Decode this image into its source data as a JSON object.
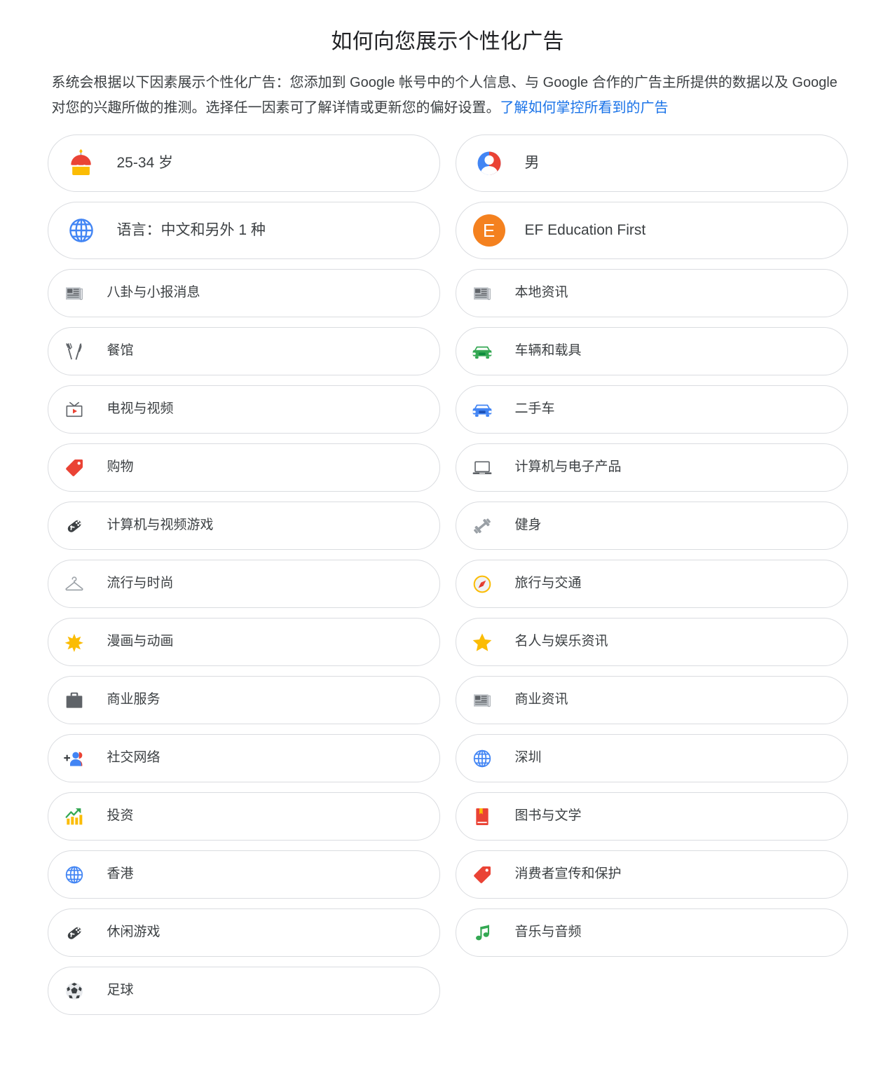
{
  "header": {
    "title": "如何向您展示个性化广告",
    "intro_text": "系统会根据以下因素展示个性化广告：您添加到 Google 帐号中的个人信息、与 Google 合作的广告主所提供的数据以及 Google 对您的兴趣所做的推测。选择任一因素可了解详情或更新您的偏好设置。",
    "intro_link": "了解如何掌控所看到的广告",
    "link_color": "#1a73e8"
  },
  "cards": {
    "left": [
      {
        "label": "25-34 岁",
        "icon": "birthday-cake-icon",
        "size": "big"
      },
      {
        "label": "语言：中文和另外 1 种",
        "icon": "globe-icon",
        "size": "big"
      },
      {
        "label": "八卦与小报消息",
        "icon": "newspaper-icon",
        "size": "small"
      },
      {
        "label": "餐馆",
        "icon": "restaurant-icon",
        "size": "small"
      },
      {
        "label": "电视与视频",
        "icon": "television-icon",
        "size": "small"
      },
      {
        "label": "购物",
        "icon": "price-tag-icon",
        "size": "small"
      },
      {
        "label": "计算机与视频游戏",
        "icon": "gamepad-icon",
        "size": "small"
      },
      {
        "label": "流行与时尚",
        "icon": "clothes-hanger-icon",
        "size": "small"
      },
      {
        "label": "漫画与动画",
        "icon": "sparkle-star-icon",
        "size": "small"
      },
      {
        "label": "商业服务",
        "icon": "briefcase-icon",
        "size": "small"
      },
      {
        "label": "社交网络",
        "icon": "add-person-icon",
        "size": "small"
      },
      {
        "label": "投资",
        "icon": "growth-chart-icon",
        "size": "small"
      },
      {
        "label": "香港",
        "icon": "globe-icon",
        "size": "small"
      },
      {
        "label": "休闲游戏",
        "icon": "gamepad-icon",
        "size": "small"
      },
      {
        "label": "足球",
        "icon": "soccer-ball-icon",
        "size": "small"
      }
    ],
    "right": [
      {
        "label": "男",
        "icon": "person-avatar-icon",
        "size": "big"
      },
      {
        "label": "EF Education First",
        "icon": "letter-avatar-E",
        "size": "big"
      },
      {
        "label": "本地资讯",
        "icon": "newspaper-icon",
        "size": "small"
      },
      {
        "label": "车辆和载具",
        "icon": "car-green-icon",
        "size": "small"
      },
      {
        "label": "二手车",
        "icon": "car-blue-icon",
        "size": "small"
      },
      {
        "label": "计算机与电子产品",
        "icon": "laptop-icon",
        "size": "small"
      },
      {
        "label": "健身",
        "icon": "dumbbell-icon",
        "size": "small"
      },
      {
        "label": "旅行与交通",
        "icon": "compass-icon",
        "size": "small"
      },
      {
        "label": "名人与娱乐资讯",
        "icon": "star-icon",
        "size": "small"
      },
      {
        "label": "商业资讯",
        "icon": "newspaper-icon",
        "size": "small"
      },
      {
        "label": "深圳",
        "icon": "globe-icon",
        "size": "small"
      },
      {
        "label": "图书与文学",
        "icon": "book-icon",
        "size": "small"
      },
      {
        "label": "消费者宣传和保护",
        "icon": "price-tag-icon",
        "size": "small"
      },
      {
        "label": "音乐与音频",
        "icon": "music-note-icon",
        "size": "small"
      }
    ]
  },
  "colors": {
    "card_border": "#dadce0",
    "text": "#3c4043",
    "title": "#202124",
    "google_blue": "#1a73e8",
    "orange_avatar": "#f4811f"
  }
}
